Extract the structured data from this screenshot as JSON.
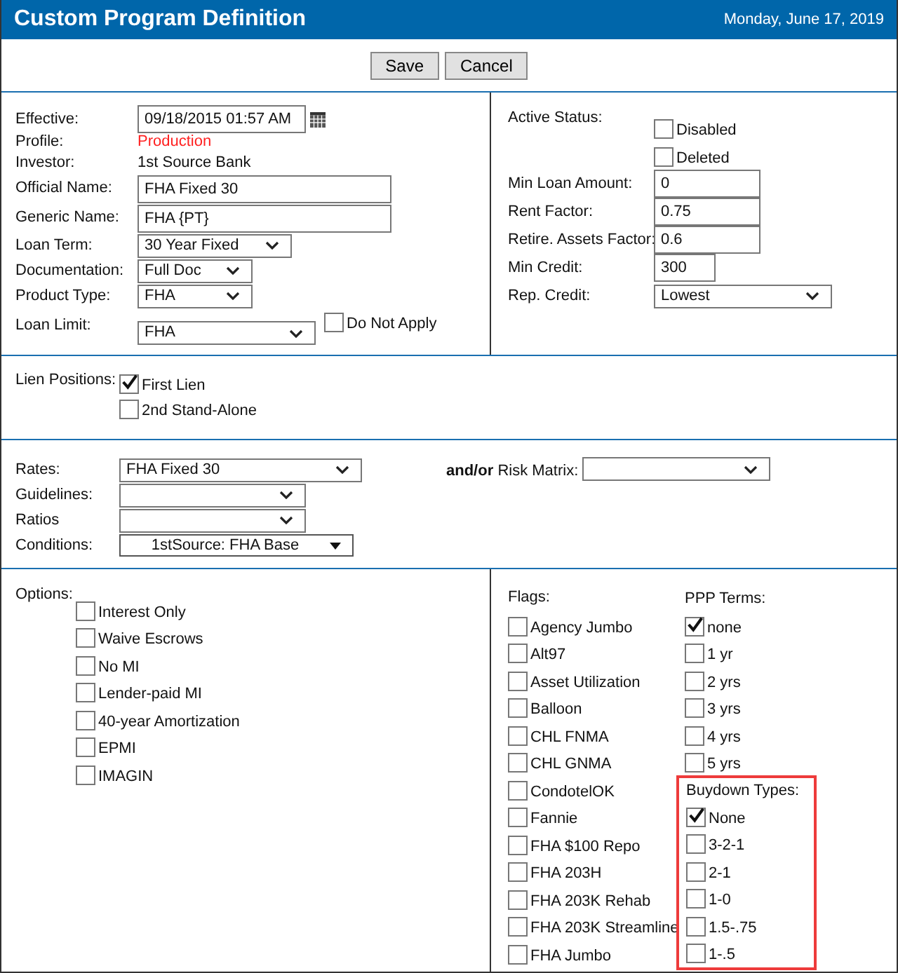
{
  "header": {
    "title": "Custom Program Definition",
    "date": "Monday, June 17, 2019"
  },
  "buttons": [
    "Save",
    "Cancel"
  ],
  "general": [
    {
      "label": "Effective:",
      "kind": "datetime",
      "value": "09/18/2015 01:57 AM"
    },
    {
      "label": "Profile:",
      "kind": "highlight",
      "value": "Production"
    },
    {
      "label": "Investor:",
      "kind": "static",
      "value": "1st Source Bank"
    },
    {
      "label": "Official Name:",
      "kind": "input",
      "value": "FHA Fixed 30"
    },
    {
      "label": "Generic Name:",
      "kind": "input",
      "value": "FHA {PT}"
    },
    {
      "label": "Loan Term:",
      "kind": "select",
      "value": "30 Year Fixed"
    },
    {
      "label": "Documentation:",
      "kind": "select",
      "value": "Full Doc"
    },
    {
      "label": "Product Type:",
      "kind": "select",
      "value": "FHA"
    },
    {
      "label": "Loan Limit:",
      "kind": "select",
      "value": "FHA",
      "checkbox": {
        "label": "Do Not Apply",
        "checked": false
      }
    }
  ],
  "status": {
    "label": "Active Status:",
    "options": [
      {
        "label": "Disabled",
        "checked": false
      },
      {
        "label": "Deleted",
        "checked": false
      }
    ]
  },
  "limits": [
    {
      "label": "Min Loan Amount:",
      "kind": "input",
      "value": "0"
    },
    {
      "label": "Rent Factor:",
      "kind": "input",
      "value": "0.75"
    },
    {
      "label": "Retire. Assets Factor:",
      "kind": "input",
      "value": "0.6"
    },
    {
      "label": "Min Credit:",
      "kind": "input",
      "value": "300"
    },
    {
      "label": "Rep. Credit:",
      "kind": "select",
      "value": "Lowest"
    }
  ],
  "lien": {
    "label": "Lien Positions:",
    "options": [
      {
        "label": "First Lien",
        "checked": true
      },
      {
        "label": "2nd Stand-Alone",
        "checked": false
      }
    ]
  },
  "rates": [
    {
      "label": "Rates:",
      "kind": "select",
      "value": "FHA Fixed 30"
    },
    {
      "label": "Guidelines:",
      "kind": "select"
    },
    {
      "label": "Ratios",
      "kind": "select"
    },
    {
      "label": "Conditions:",
      "kind": "dropdown",
      "value": "1stSource: FHA Base"
    }
  ],
  "risk_matrix": {
    "prefix": "and/or",
    "label": "Risk Matrix:"
  },
  "options": {
    "label": "Options:",
    "items": [
      {
        "label": "Interest Only",
        "checked": false
      },
      {
        "label": "Waive Escrows",
        "checked": false
      },
      {
        "label": "No MI",
        "checked": false
      },
      {
        "label": "Lender-paid MI",
        "checked": false
      },
      {
        "label": "40-year Amortization",
        "checked": false
      },
      {
        "label": "EPMI",
        "checked": false
      },
      {
        "label": "IMAGIN",
        "checked": false
      }
    ]
  },
  "flags": {
    "label": "Flags:",
    "items": [
      {
        "label": "Agency Jumbo",
        "checked": false
      },
      {
        "label": "Alt97",
        "checked": false
      },
      {
        "label": "Asset Utilization",
        "checked": false
      },
      {
        "label": "Balloon",
        "checked": false
      },
      {
        "label": "CHL FNMA",
        "checked": false
      },
      {
        "label": "CHL GNMA",
        "checked": false
      },
      {
        "label": "CondotelOK",
        "checked": false
      },
      {
        "label": "Fannie",
        "checked": false
      },
      {
        "label": "FHA $100 Repo",
        "checked": false
      },
      {
        "label": "FHA 203H",
        "checked": false
      },
      {
        "label": "FHA 203K Rehab",
        "checked": false
      },
      {
        "label": "FHA 203K Streamline",
        "checked": false
      },
      {
        "label": "FHA Jumbo",
        "checked": false
      }
    ]
  },
  "ppp_terms": {
    "label": "PPP Terms:",
    "items": [
      {
        "label": "none",
        "checked": true
      },
      {
        "label": "1 yr",
        "checked": false
      },
      {
        "label": "2 yrs",
        "checked": false
      },
      {
        "label": "3 yrs",
        "checked": false
      },
      {
        "label": "4 yrs",
        "checked": false
      },
      {
        "label": "5 yrs",
        "checked": false
      }
    ]
  },
  "buydown_types": {
    "label": "Buydown Types:",
    "highlighted": true,
    "items": [
      {
        "label": "None",
        "checked": true
      },
      {
        "label": "3-2-1",
        "checked": false
      },
      {
        "label": "2-1",
        "checked": false
      },
      {
        "label": "1-0",
        "checked": false
      },
      {
        "label": "1.5-.75",
        "checked": false
      },
      {
        "label": "1-.5",
        "checked": false
      }
    ]
  }
}
